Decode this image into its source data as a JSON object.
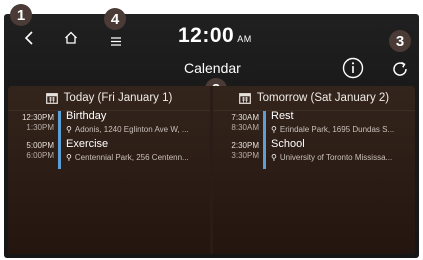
{
  "callouts": [
    "1",
    "4",
    "2",
    "3"
  ],
  "status": {
    "time": "12:00",
    "ampm": "AM"
  },
  "header": {
    "title": "Calendar"
  },
  "icons": {
    "back": "chevron-left-icon",
    "home": "home-icon",
    "menu": "menu-icon",
    "info": "info-icon",
    "refresh": "refresh-icon",
    "calendar": "calendar-icon",
    "location": "location-pin-icon"
  },
  "columns": [
    {
      "header": "Today (Fri January 1)",
      "events": [
        {
          "start": "12:30PM",
          "end": "1:30PM",
          "name": "Birthday",
          "location": "Adonis, 1240 Eglinton Ave W, ..."
        },
        {
          "start": "5:00PM",
          "end": "6:00PM",
          "name": "Exercise",
          "location": "Centennial Park, 256 Centenn..."
        }
      ]
    },
    {
      "header": "Tomorrow (Sat January 2)",
      "events": [
        {
          "start": "7:30AM",
          "end": "8:30AM",
          "name": "Rest",
          "location": "Erindale Park, 1695 Dundas S..."
        },
        {
          "start": "2:30PM",
          "end": "3:30PM",
          "name": "School",
          "location": "University of Toronto Mississa..."
        }
      ]
    }
  ],
  "colors": {
    "accent": "#5b9fd6",
    "callout": "#4a3b36",
    "panel": "#2a1d17"
  }
}
